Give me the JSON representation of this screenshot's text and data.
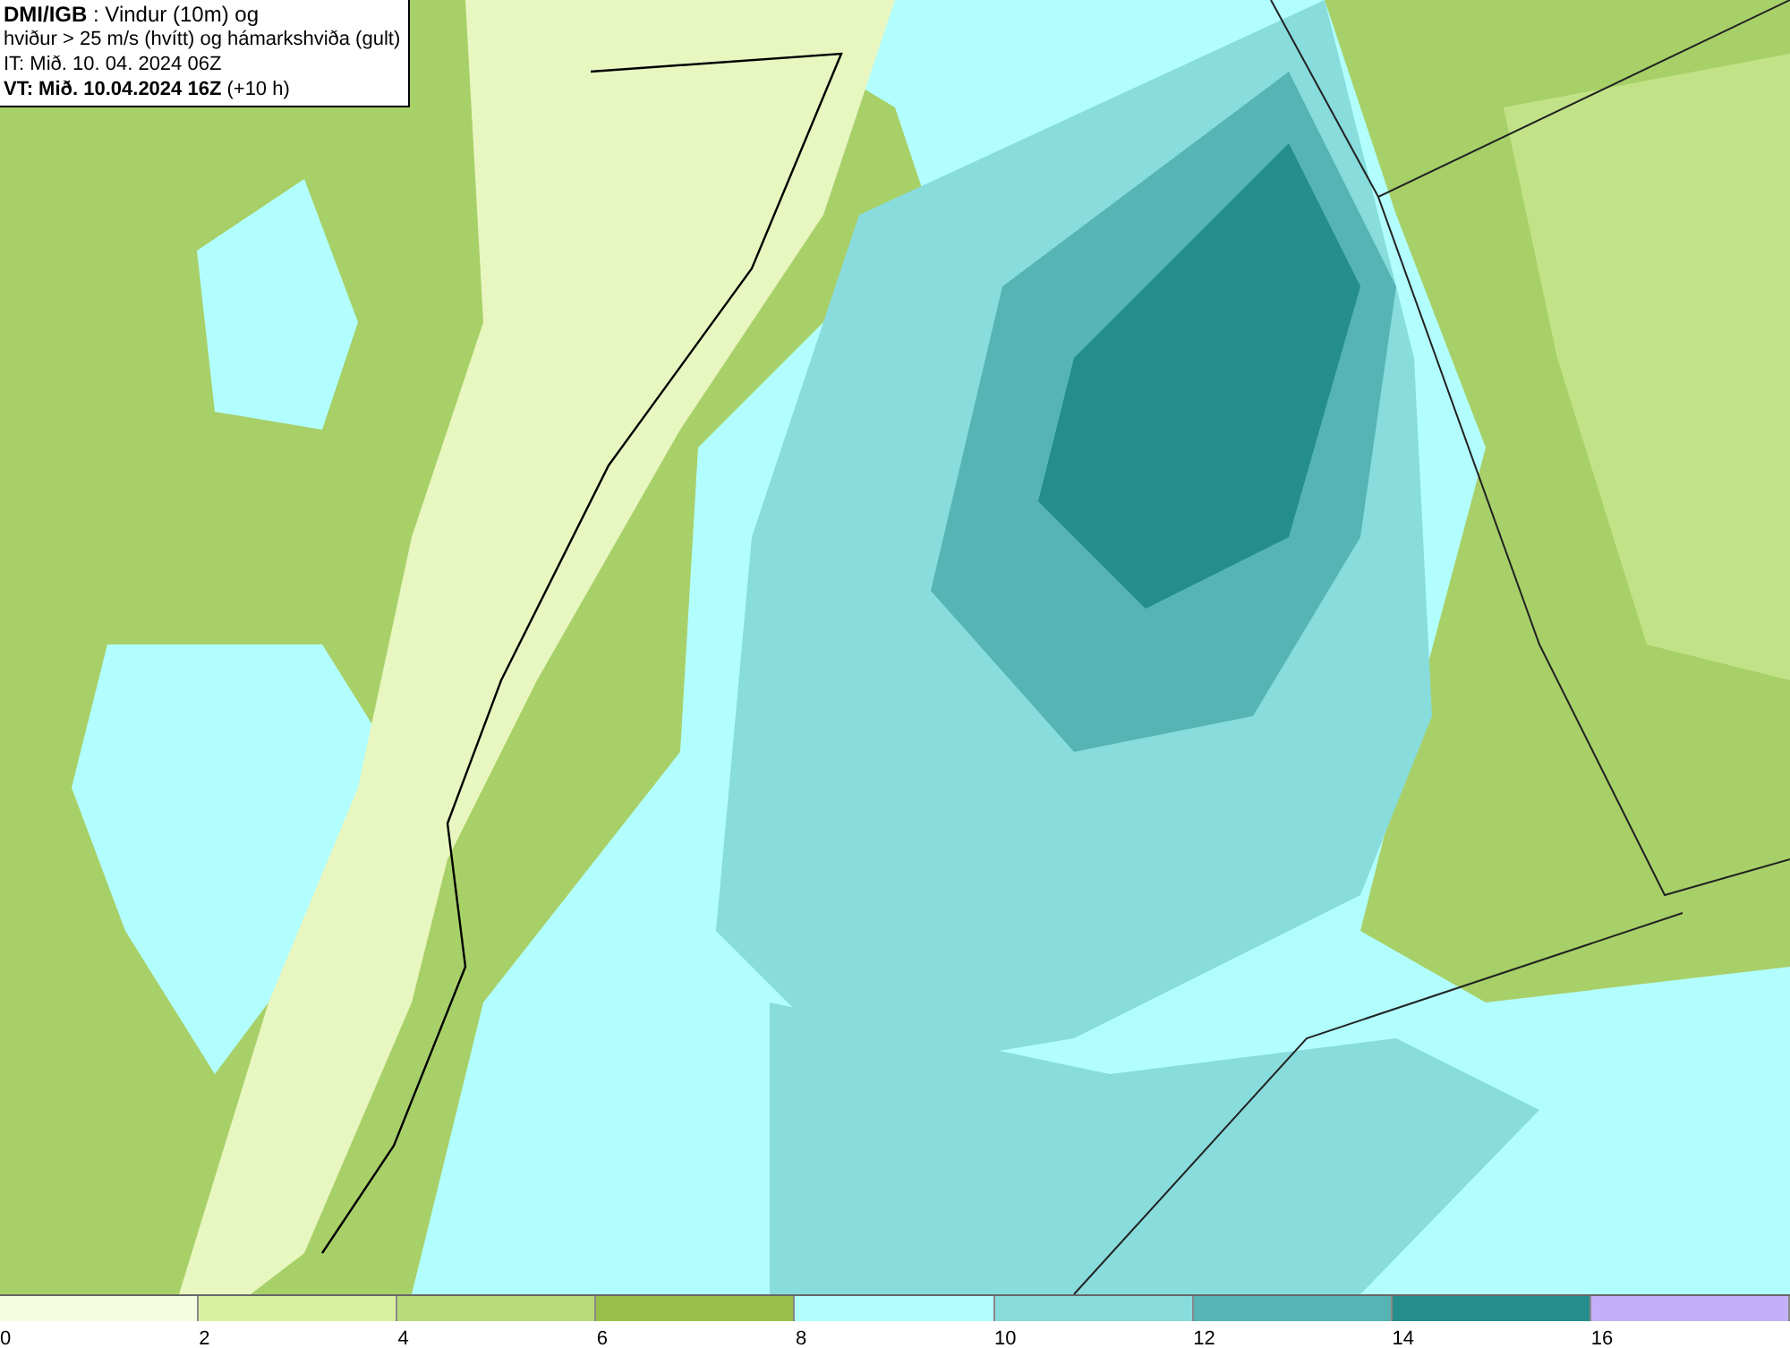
{
  "title_box": {
    "lines": [
      "**DMI/IGB** : Vindur (10m) og",
      "hviður > 25 m/s (hvítt) og hámarkshviða (gult)",
      "IT: Mið. 10. 04. 2024 06Z",
      "**VT: Mið. 10.04.2024 16Z** (+10 h)"
    ]
  },
  "legend": {
    "bins": [
      {
        "color": "#f5fde0"
      },
      {
        "color": "#d9f0a0"
      },
      {
        "color": "#b8dc78"
      },
      {
        "color": "#98c048"
      },
      {
        "color": "#b2feff"
      },
      {
        "color": "#88dcdc"
      },
      {
        "color": "#56b4b4"
      },
      {
        "color": "#238e8c"
      },
      {
        "color": "#c4b0f8"
      }
    ],
    "tick_labels": [
      "0",
      "2",
      "4",
      "6",
      "8",
      "10",
      "12",
      "14",
      "16"
    ]
  }
}
